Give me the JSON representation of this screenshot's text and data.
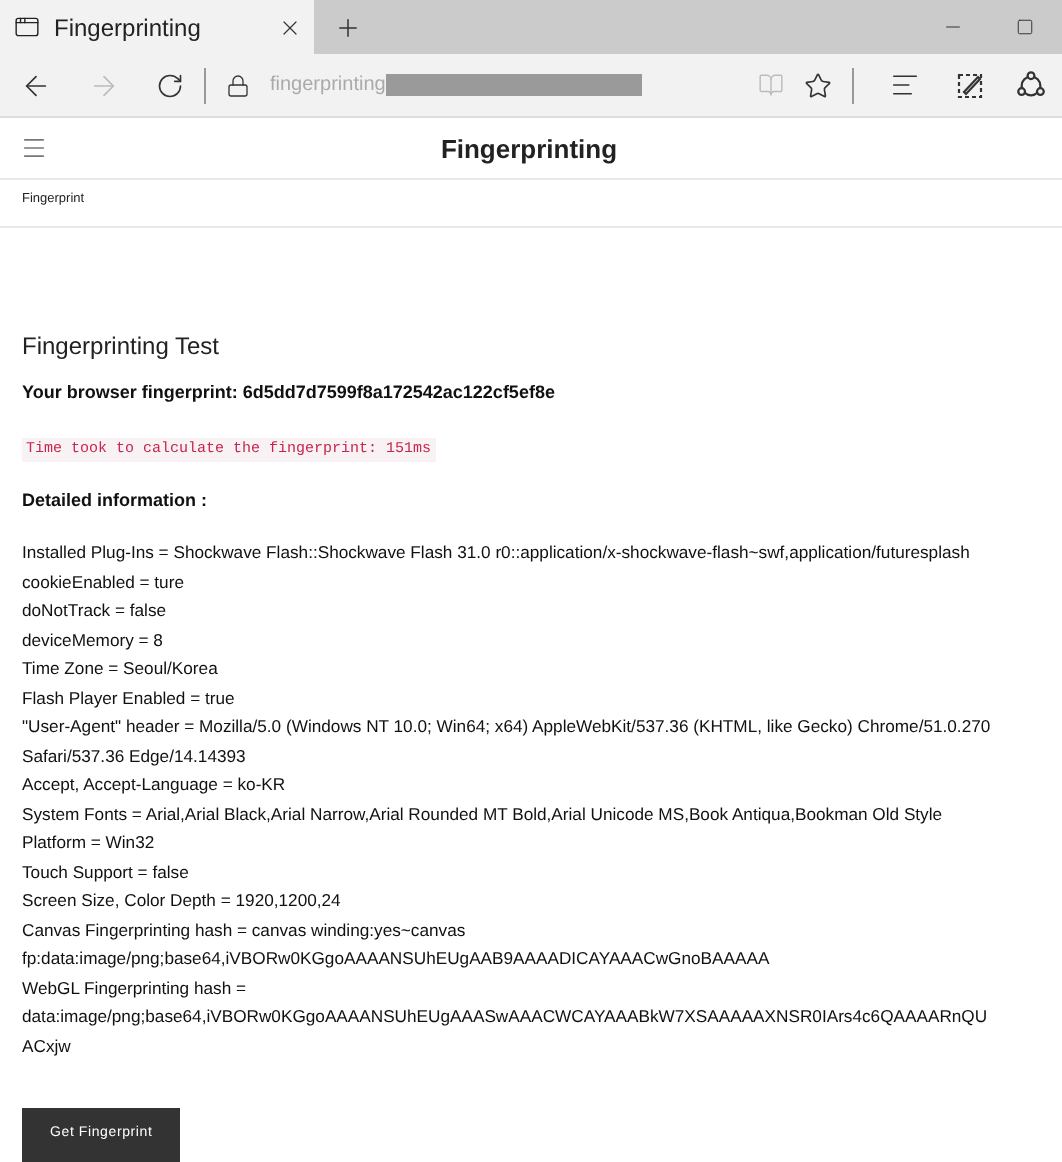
{
  "browser": {
    "tab": {
      "title": "Fingerprinting",
      "selected": true
    },
    "address": "fingerprinting"
  },
  "site": {
    "title": "Fingerprinting",
    "breadcrumb": "Fingerprint"
  },
  "content": {
    "heading": "Fingerprinting Test",
    "fingerprint": "Your browser fingerprint: 6d5dd7d7599f8a172542ac122cf5ef8e",
    "timing": "Time took to calculate the fingerprint: 151ms",
    "details_heading": "Detailed information :",
    "details": [
      "Installed  Plug-Ins = Shockwave Flash::Shockwave Flash 31.0 r0::application/x-shockwave-flash~swf,application/futuresplash",
      "cookieEnabled = ture",
      "doNotTrack = false",
      "deviceMemory = 8",
      "Time  Zone = Seoul/Korea",
      "Flash  Player Enabled = true",
      "\"User-Agent\"  header = Mozilla/5.0 (Windows NT 10.0; Win64; x64) AppleWebKit/537.36 (KHTML, like Gecko) Chrome/51.0.270",
      "Safari/537.36 Edge/14.14393",
      "Accept,  Accept-Language = ko-KR",
      "System  Fonts = Arial,Arial Black,Arial Narrow,Arial Rounded MT Bold,Arial Unicode MS,Book Antiqua,Bookman Old Style",
      "Platform = Win32",
      "Touch  Support = false",
      "Screen  Size, Color Depth = 1920,1200,24",
      "Canvas  Fingerprinting hash = canvas winding:yes~canvas",
      "fp:data:image/png;base64,iVBORw0KGgoAAAANSUhEUgAAB9AAAADICAYAAACwGnoBAAAAA",
      "WebGL  Fingerprinting hash =",
      "data:image/png;base64,iVBORw0KGgoAAAANSUhEUgAAASwAAACWCAYAAABkW7XSAAAAAXNSR0IArs4c6QAAAARnQU",
      "ACxjw"
    ],
    "button": "Get Fingerprint"
  }
}
